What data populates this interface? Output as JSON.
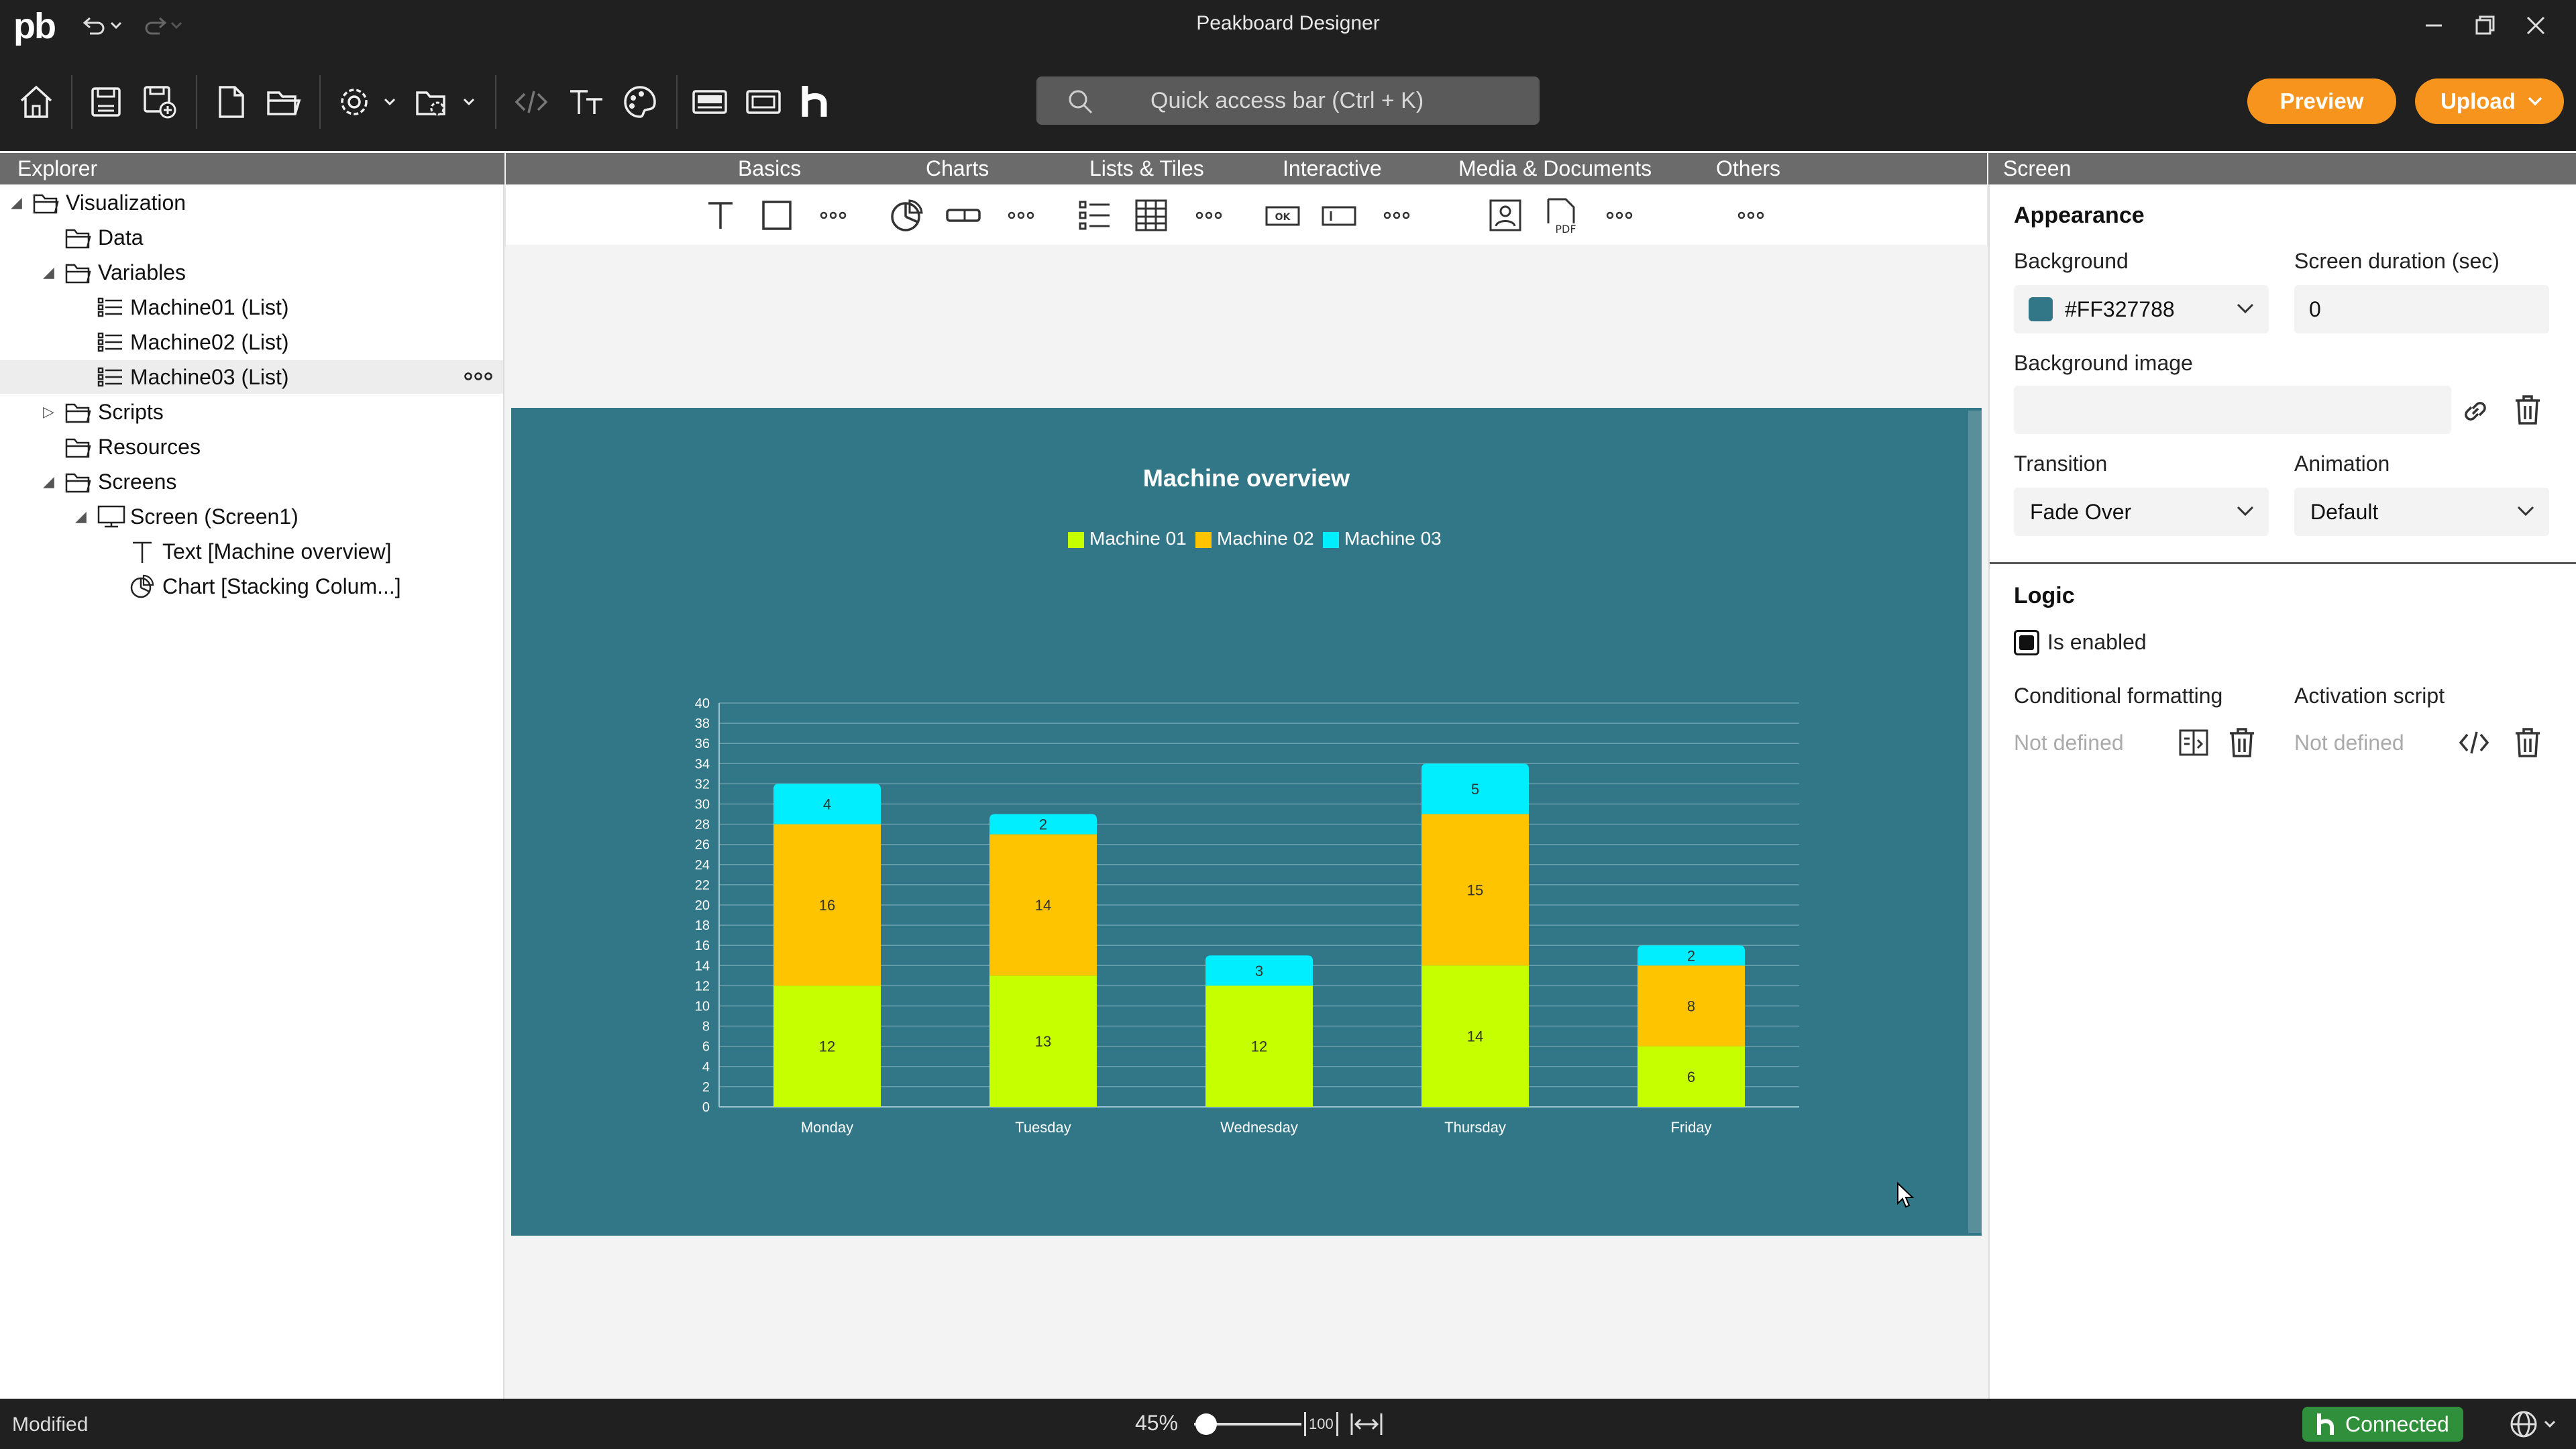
{
  "app": {
    "logo": "pb",
    "title": "Peakboard Designer",
    "search_placeholder": "Quick access bar (Ctrl + K)",
    "preview_label": "Preview",
    "upload_label": "Upload"
  },
  "explorer": {
    "header": "Explorer",
    "items": [
      {
        "label": "Visualization",
        "icon": "folder-icon"
      },
      {
        "label": "Data",
        "icon": "folder-icon"
      },
      {
        "label": "Variables",
        "icon": "folder-icon"
      },
      {
        "label": "Machine01 (List)",
        "icon": "list-icon"
      },
      {
        "label": "Machine02 (List)",
        "icon": "list-icon"
      },
      {
        "label": "Machine03 (List)",
        "icon": "list-icon"
      },
      {
        "label": "Scripts",
        "icon": "folder-icon"
      },
      {
        "label": "Resources",
        "icon": "folder-icon"
      },
      {
        "label": "Screens",
        "icon": "folder-icon"
      },
      {
        "label": "Screen (Screen1)",
        "icon": "monitor-icon"
      },
      {
        "label": "Text [Machine overview]",
        "icon": "text-icon"
      },
      {
        "label": "Chart [Stacking Colum...]",
        "icon": "chart-icon"
      }
    ]
  },
  "categories": [
    "Basics",
    "Charts",
    "Lists & Tiles",
    "Interactive",
    "Media & Documents",
    "Others"
  ],
  "components": {
    "ok_label": "OK",
    "pdf_label": "PDF"
  },
  "properties": {
    "header": "Screen",
    "appearance_title": "Appearance",
    "background_label": "Background",
    "background_value": "#FF327788",
    "background_color": "#327788",
    "duration_label": "Screen duration (sec)",
    "duration_value": "0",
    "bg_image_label": "Background image",
    "transition_label": "Transition",
    "transition_value": "Fade Over",
    "animation_label": "Animation",
    "animation_value": "Default",
    "logic_title": "Logic",
    "enabled_label": "Is enabled",
    "cond_format_label": "Conditional formatting",
    "cond_format_value": "Not defined",
    "activation_label": "Activation script",
    "activation_value": "Not defined"
  },
  "status": {
    "state": "Modified",
    "zoom": "45%",
    "connected": "Connected",
    "zoom_fit_label": "100"
  },
  "chart_data": {
    "type": "bar",
    "stacked": true,
    "title": "Machine overview",
    "categories": [
      "Monday",
      "Tuesday",
      "Wednesday",
      "Thursday",
      "Friday"
    ],
    "series": [
      {
        "name": "Machine 01",
        "color": "#c5ff00",
        "values": [
          12,
          13,
          12,
          14,
          6
        ]
      },
      {
        "name": "Machine 02",
        "color": "#ffc400",
        "values": [
          16,
          14,
          0,
          15,
          8
        ]
      },
      {
        "name": "Machine 03",
        "color": "#00eeff",
        "values": [
          4,
          2,
          3,
          5,
          2
        ]
      }
    ],
    "ylim": [
      0,
      40
    ],
    "y_ticks": [
      "0",
      "2",
      "4",
      "6",
      "8",
      "10",
      "12",
      "14",
      "16",
      "18",
      "20",
      "22",
      "24",
      "26",
      "28",
      "30",
      "32",
      "34",
      "36",
      "38",
      "40"
    ],
    "grid": true,
    "legend": "top-center"
  }
}
